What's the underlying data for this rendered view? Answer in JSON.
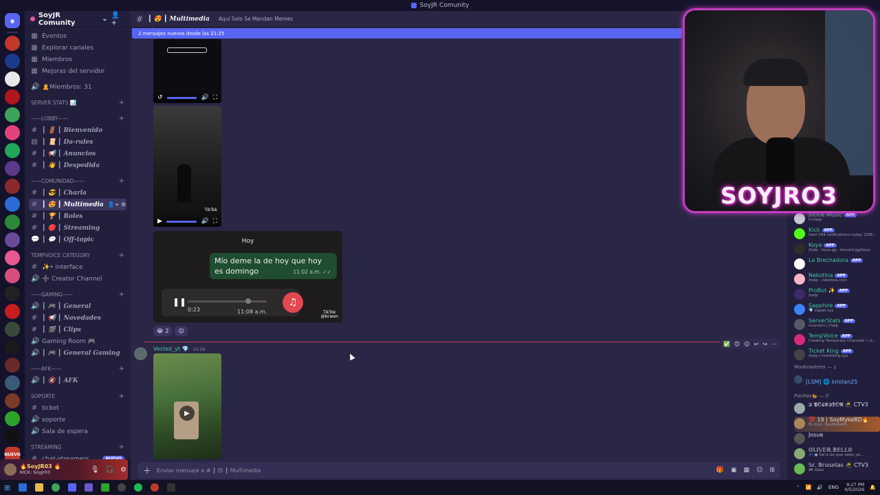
{
  "window": {
    "title": "SoyJR Comunity"
  },
  "server": {
    "name": "SoyJR Comunity",
    "top_items": [
      {
        "icon": "calendar-icon",
        "label": "Eventos"
      },
      {
        "icon": "explore-icon",
        "label": "Explorar canales"
      },
      {
        "icon": "members-icon",
        "label": "Miembros"
      },
      {
        "icon": "boost-icon",
        "label": "Mejoras del servidor"
      }
    ],
    "members_count_channel": "🙎Miembros: 31"
  },
  "categories": [
    {
      "name": "SERVER STATS 📊",
      "channels": []
    },
    {
      "name": "——LOBBY——",
      "channels": [
        {
          "icon": "#",
          "label": "┃ 🚪 ┃ Bienvenido",
          "fancy": true
        },
        {
          "icon": "▤",
          "label": "┃ 📜 ┃ Da-rules",
          "fancy": true
        },
        {
          "icon": "#",
          "label": "┃ 📢 ┃ Anuncios",
          "fancy": true
        },
        {
          "icon": "#",
          "label": "┃ 👋 ┃ Despedida",
          "fancy": true
        }
      ]
    },
    {
      "name": "——COMUNIDAD——",
      "channels": [
        {
          "icon": "#",
          "label": "┃ 😎 ┃ Charla",
          "fancy": true
        },
        {
          "icon": "#",
          "label": "┃ 😍 ┃ Multimedia",
          "fancy": true,
          "active": true
        },
        {
          "icon": "#",
          "label": "┃ 🏆 ┃ Roles",
          "fancy": true
        },
        {
          "icon": "#",
          "label": "┃ 🔴 ┃ Streaming",
          "fancy": true
        },
        {
          "icon": "💬",
          "label": "┃ 💬 ┃ Off-topic",
          "fancy": true
        }
      ]
    },
    {
      "name": "TEMPVOICE CATEGORY",
      "channels": [
        {
          "icon": "#",
          "label": "✨• interface",
          "fancy": false
        },
        {
          "icon": "🔊",
          "label": "➕ Creator Channel",
          "fancy": false
        }
      ]
    },
    {
      "name": "——GAMING——",
      "channels": [
        {
          "icon": "🔊",
          "label": "┃ 🎮 ┃ General",
          "fancy": true
        },
        {
          "icon": "#",
          "label": "┃ 📢 ┃ Novedades",
          "fancy": true
        },
        {
          "icon": "#",
          "label": "┃ 🎬 ┃ Clips",
          "fancy": true
        },
        {
          "icon": "🔊",
          "label": "Gaming Room 🎮",
          "fancy": false
        },
        {
          "icon": "🔊",
          "label": "┃ 🎮 ┃ General Gaming",
          "fancy": true
        }
      ]
    },
    {
      "name": "——AFK——",
      "channels": [
        {
          "icon": "🔊",
          "label": "┃ 🔇 ┃ AFK",
          "fancy": true
        }
      ]
    },
    {
      "name": "Soporte",
      "channels": [
        {
          "icon": "#",
          "label": "ticket",
          "fancy": false
        },
        {
          "icon": "🔊",
          "label": "soporte",
          "fancy": false
        },
        {
          "icon": "🔊",
          "label": "Sala de espera",
          "fancy": false
        }
      ]
    },
    {
      "name": "Streaming",
      "channels": [
        {
          "icon": "#",
          "label": "chat-streamers",
          "fancy": false,
          "badge": "NUEVO"
        }
      ]
    }
  ],
  "user_panel": {
    "name": "🔥SoyJR03 🔥",
    "status": "KICK: SoyJr03"
  },
  "channel_header": {
    "title": "┃ 😍 ┃ Multimedia",
    "topic": "Aqui Solo Se Mandan Memes"
  },
  "new_messages_bar": "2 mensajes nuevos desde las 21:25",
  "whatsapp": {
    "day": "Hoy",
    "bubble_text": "Mío deme la de hoy que hoy es domingo",
    "bubble_time": "11:02 a.m. ✓✓",
    "audio_duration": "0:23",
    "audio_time": "11:08 a.m.",
    "tiktok": "TikTok",
    "tiktok_user": "@bcwen"
  },
  "reactions": [
    {
      "emoji": "😂",
      "count": "2"
    },
    {
      "emoji": "☺",
      "count": ""
    }
  ],
  "message2": {
    "author": "Vested_yt 💎",
    "time": "21:26"
  },
  "composer": {
    "placeholder": "Enviar mensaje a # ┃ 😍 ┃ Multimedia"
  },
  "members": [
    {
      "name": "Jockie Music",
      "tag": "APP",
      "status": "m!help",
      "color": "#c9c9d4"
    },
    {
      "name": "Kick",
      "tag": "APP",
      "status": "Sent 264 notifications today. (338...",
      "color": "#53fc18"
    },
    {
      "name": "Koya",
      "tag": "APP",
      "status": "/help · koya.gg · discord.gg/koya",
      "color": "#2d2d2d"
    },
    {
      "name": "La Brechadora",
      "tag": "APP",
      "status": "",
      "color": "#ffffff"
    },
    {
      "name": "Nekotina",
      "tag": "APP",
      "status": "/help · nekotina.com",
      "color": "#f4b6c8"
    },
    {
      "name": "ProBot ✨",
      "tag": "APP",
      "status": "/help",
      "color": "#3d2a66"
    },
    {
      "name": "Sapphire",
      "tag": "APP",
      "status": "💎 sapph.xyz",
      "color": "#3b82f6"
    },
    {
      "name": "ServerStats",
      "tag": "APP",
      "status": "counters | /help",
      "color": "#555a66"
    },
    {
      "name": "TempVoice",
      "tag": "APP",
      "status": "Creating Temporary Channels • /s...",
      "color": "#d62a7a"
    },
    {
      "name": "Ticket King",
      "tag": "APP",
      "status": "/help | ticketking.xyz",
      "color": "#444"
    }
  ],
  "member_groups": {
    "mods": "Moderadores — 1",
    "mod_member": "[LSM] 🌐 kristan25",
    "panitas": "Panitas🐆 — 5",
    "panitas_members": [
      {
        "name": "𝕴 𝕻𝕺𝕾𝕰𝕴𝕯𝕺𝕹 🥷 CTV3",
        "status": "",
        "color": "#9aa"
      },
      {
        "name": "💯 19 | SoyMykeRD🔥",
        "status": "En Kick: SoyMykeRD",
        "color": "#a8885a"
      },
      {
        "name": "Josue",
        "status": "",
        "color": "#555"
      },
      {
        "name": "𝕆𝕃𝕀𝕍𝔼ℝ.𝔹𝔼𝕃𝕃𝕆",
        "status": "💤 ● Sal a las que salen ya...",
        "color": "#8a7"
      },
      {
        "name": "𝕊𝕣. 𝔹𝕣𝕦𝕤𝕖𝕝𝕒𝕤 🥷 CTV3",
        "status": "🎮 Xbox",
        "color": "#6b5"
      }
    ]
  },
  "webcam": {
    "name": "SOYJRO3"
  },
  "taskbar": {
    "time": "9:27 PM",
    "date": "4/5/2026",
    "lang": "ENG"
  },
  "colors": {
    "accent": "#5865f2",
    "bot_name": "#43c59e",
    "divider": "#c0434f"
  }
}
